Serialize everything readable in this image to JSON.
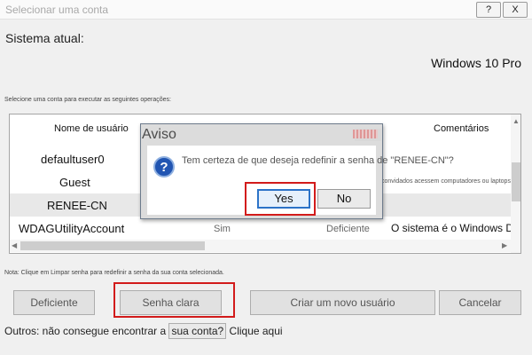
{
  "window": {
    "title": "Selecionar uma conta",
    "help_label": "?",
    "close_label": "X"
  },
  "system": {
    "label": "Sistema atual:",
    "value": "Windows 10 Pro"
  },
  "instruction": "Selecione uma conta para executar as seguintes operações:",
  "table": {
    "headers": [
      "Nome de usuário",
      "Comentários"
    ],
    "rows": [
      {
        "name": "defaultuser0"
      },
      {
        "name": "Guest",
        "comment": "Permita que os convidados acessem computadores ou laptops..."
      },
      {
        "name": "RENEE-CN",
        "selected": true
      },
      {
        "name": "WDAGUtilityAccount",
        "col2": "Sim",
        "col3": "Deficiente",
        "comment": "O sistema é o Windows De..."
      }
    ]
  },
  "note": "Nota: Clique em Limpar senha para redefinir a senha da sua conta selecionada.",
  "buttons": {
    "disable": "Deficiente",
    "clear_password": "Senha clara",
    "create_user": "Criar um novo usuário",
    "cancel": "Cancelar"
  },
  "others": {
    "text": "Outros: não consegue encontrar a",
    "link": "sua conta?",
    "suffix": "Clique aqui"
  },
  "dialog": {
    "title": "Aviso",
    "message": "Tem certeza de que deseja redefinir a senha de \"RENEE-CN\"?",
    "yes": "Yes",
    "no": "No"
  },
  "colors": {
    "highlight": "#d21b1b",
    "dialog_accent": "#2c73c8",
    "question_icon": "#2155b2"
  },
  "icons": {
    "dialog_icon": "question-icon"
  }
}
